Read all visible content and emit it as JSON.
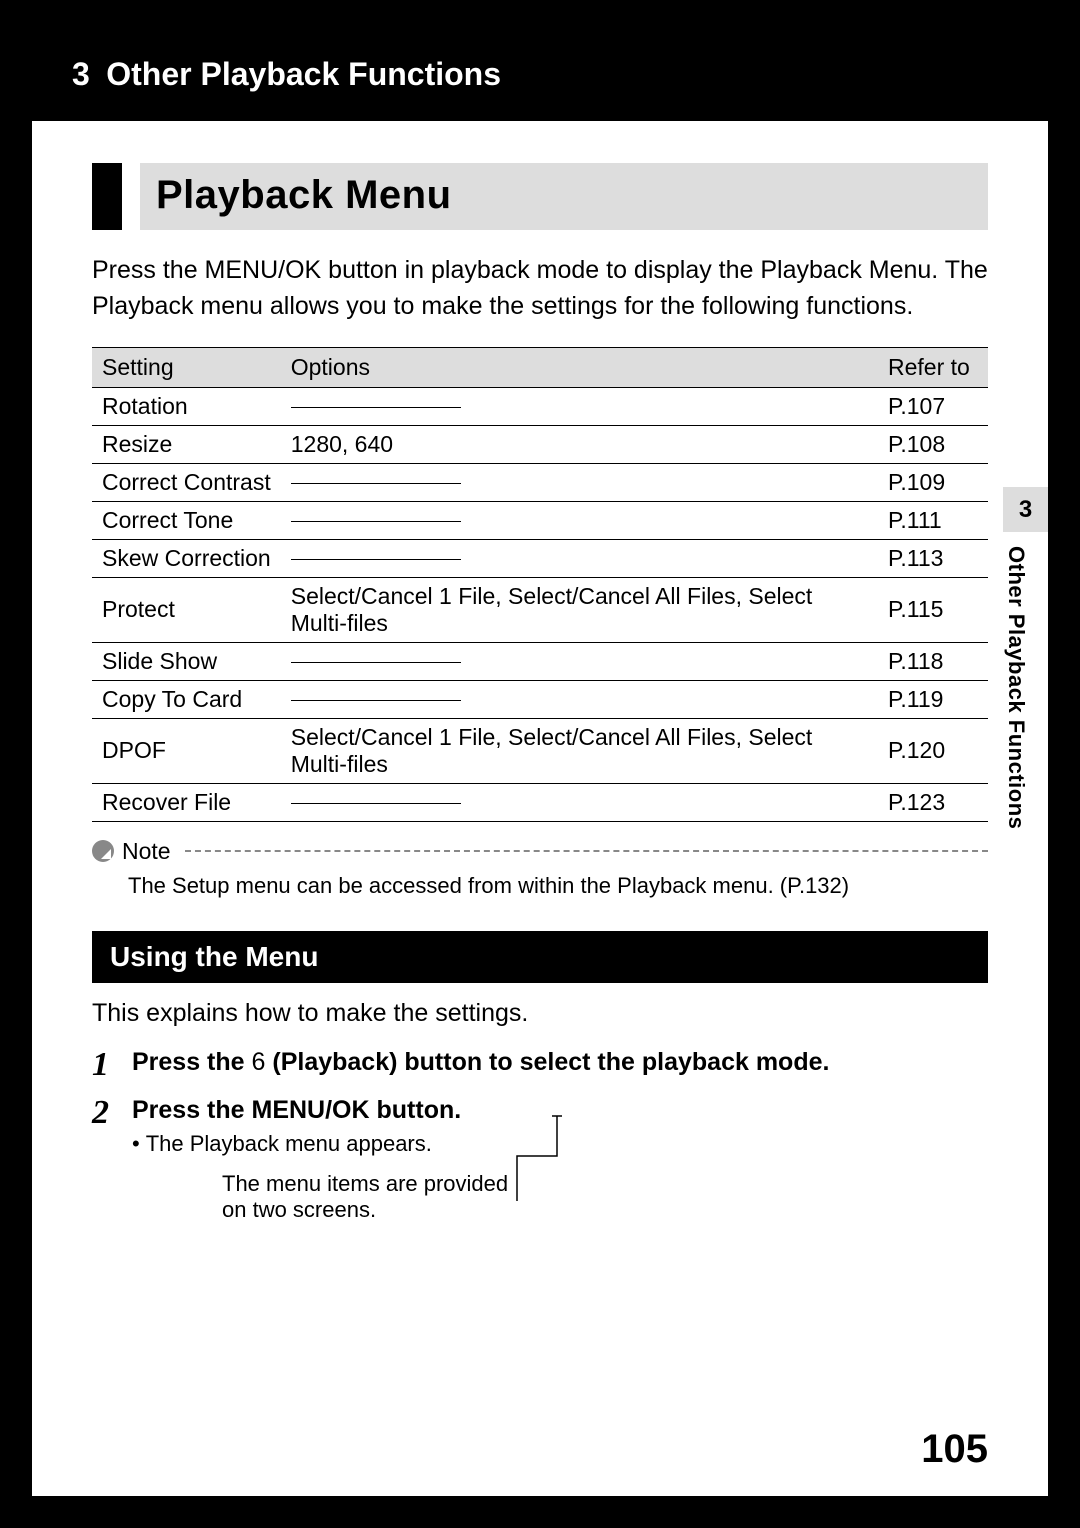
{
  "chapter": {
    "num": "3",
    "title": "Other Playback Functions"
  },
  "sidebar": {
    "num": "3",
    "label": "Other Playback Functions"
  },
  "section_title": "Playback Menu",
  "intro": "Press the MENU/OK button in playback mode to display the Playback Menu. The Playback menu allows you to make the settings for the following functions.",
  "table": {
    "headers": {
      "setting": "Setting",
      "options": "Options",
      "refer": "Refer to"
    },
    "rows": [
      {
        "setting": "Rotation",
        "options": "",
        "refer": "P.107"
      },
      {
        "setting": "Resize",
        "options": "1280, 640",
        "refer": "P.108"
      },
      {
        "setting": "Correct Contrast",
        "options": "",
        "refer": "P.109"
      },
      {
        "setting": "Correct Tone",
        "options": "",
        "refer": "P.111"
      },
      {
        "setting": "Skew Correction",
        "options": "",
        "refer": "P.113"
      },
      {
        "setting": "Protect",
        "options": "Select/Cancel 1 File, Select/Cancel All Files, Select Multi-files",
        "refer": "P.115"
      },
      {
        "setting": "Slide Show",
        "options": "",
        "refer": "P.118"
      },
      {
        "setting": "Copy To Card",
        "options": "",
        "refer": "P.119"
      },
      {
        "setting": "DPOF",
        "options": "Select/Cancel 1 File, Select/Cancel All Files, Select Multi-files",
        "refer": "P.120"
      },
      {
        "setting": "Recover File",
        "options": "",
        "refer": "P.123"
      }
    ]
  },
  "note": {
    "label": "Note",
    "body": "The Setup menu can be accessed from within the Playback menu. (",
    "ref": "P.132)"
  },
  "subhead": "Using the Menu",
  "explain": "This explains how to make the settings.",
  "steps": [
    {
      "num": "1",
      "line1_a": "Press the ",
      "line1_icon": "6",
      "line1_b": " (Playback) button to select the playback mode."
    },
    {
      "num": "2",
      "line1_a": "Press the MENU/OK button.",
      "sub": "The Playback menu appears."
    }
  ],
  "callout": "The menu items are provided on two screens.",
  "page_number": "105"
}
